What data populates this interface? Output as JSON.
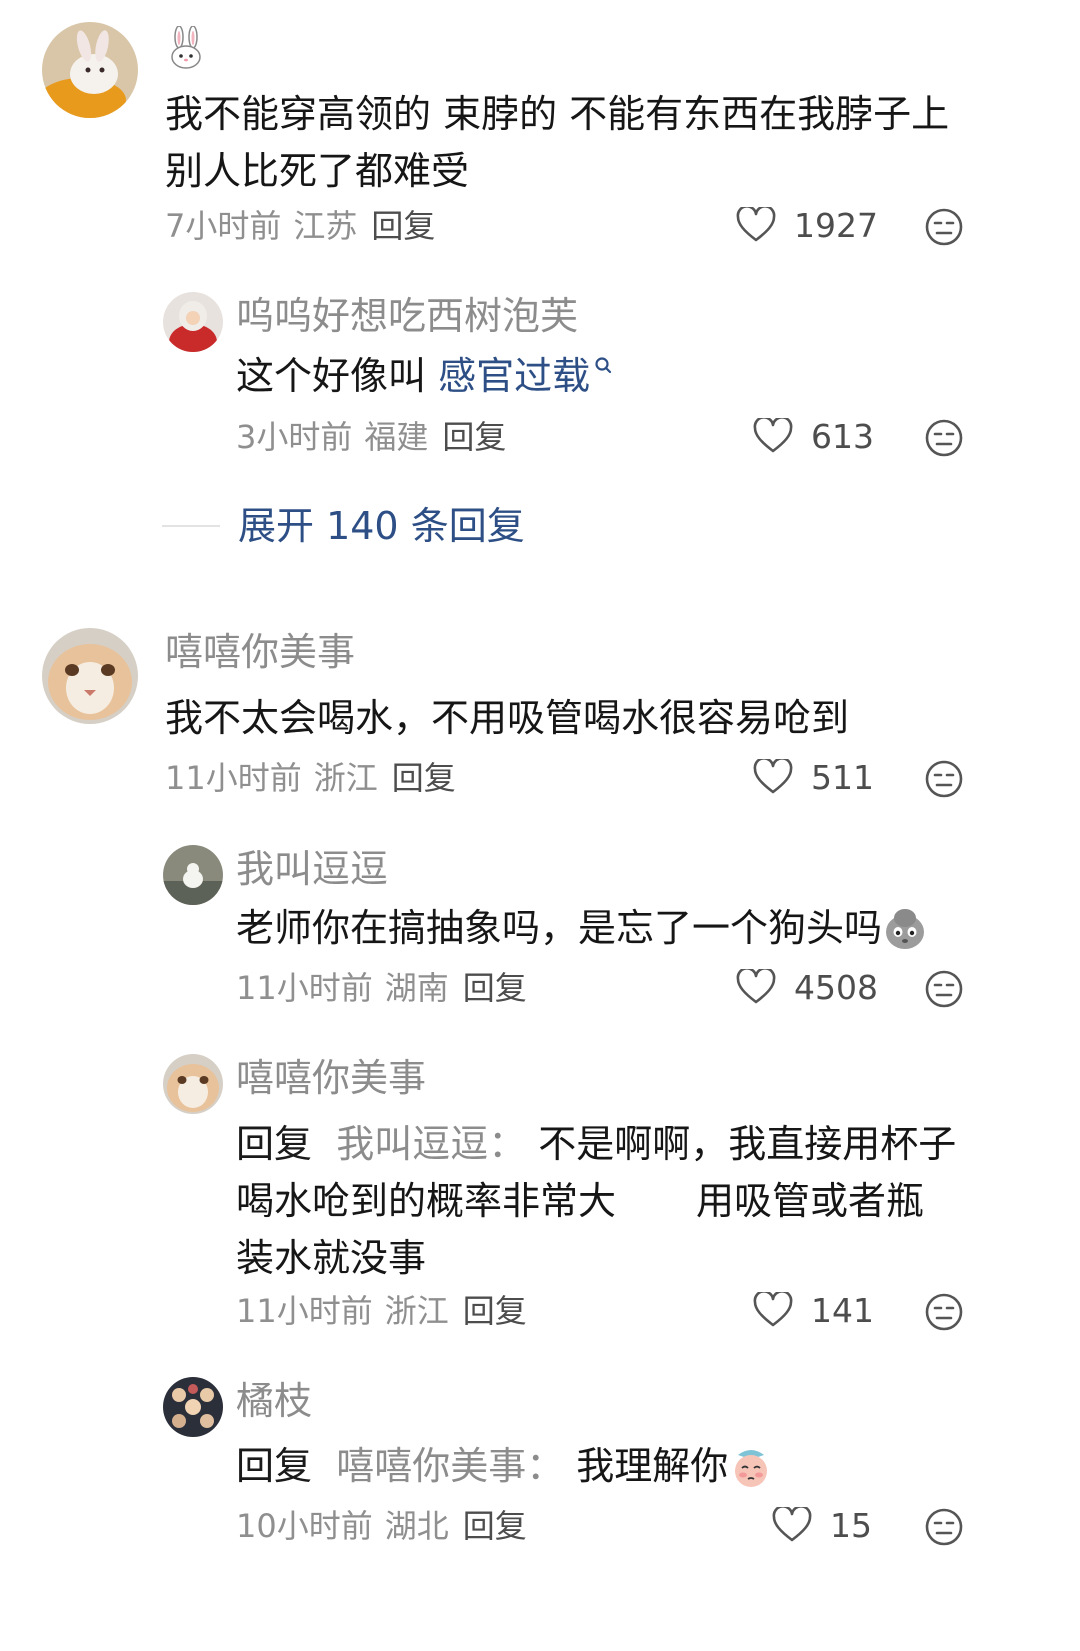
{
  "comments": [
    {
      "user": "",
      "user_icon": "rabbit-emoji",
      "text_lines": [
        "我不能穿高领的 束脖的 不能有东西在我脖子上",
        "别人比死了都难受"
      ],
      "time": "7小时前",
      "location": "江苏",
      "reply_label": "回复",
      "likes": "1927",
      "replies": [
        {
          "user": "呜呜好想吃西树泡芙",
          "text_plain": "这个好像叫 ",
          "text_link": "感官过载",
          "time": "3小时前",
          "location": "福建",
          "reply_label": "回复",
          "likes": "613"
        }
      ],
      "expand_label": "展开 140 条回复"
    },
    {
      "user": "嘻嘻你美事",
      "text_lines": [
        "我不太会喝水，不用吸管喝水很容易呛到"
      ],
      "time": "11小时前",
      "location": "浙江",
      "reply_label": "回复",
      "likes": "511",
      "replies": [
        {
          "user": "我叫逗逗",
          "text": "老师你在搞抽象吗，是忘了一个狗头吗",
          "time": "11小时前",
          "location": "湖南",
          "reply_label": "回复",
          "likes": "4508"
        },
        {
          "user": "嘻嘻你美事",
          "prefix": "回复",
          "target": "我叫逗逗：",
          "text_lines": [
            "不是啊啊，我直接用杯子",
            "喝水呛到的概率非常大",
            "用吸管或者瓶",
            "装水就没事"
          ],
          "time": "11小时前",
          "location": "浙江",
          "reply_label": "回复",
          "likes": "141"
        },
        {
          "user": "橘枝",
          "prefix": "回复",
          "target": "嘻嘻你美事：",
          "text": "我理解你",
          "time": "10小时前",
          "location": "湖北",
          "reply_label": "回复",
          "likes": "15"
        }
      ]
    }
  ],
  "colors": {
    "link": "#2d4f86",
    "muted": "#8c8c8c",
    "text": "#161616"
  }
}
